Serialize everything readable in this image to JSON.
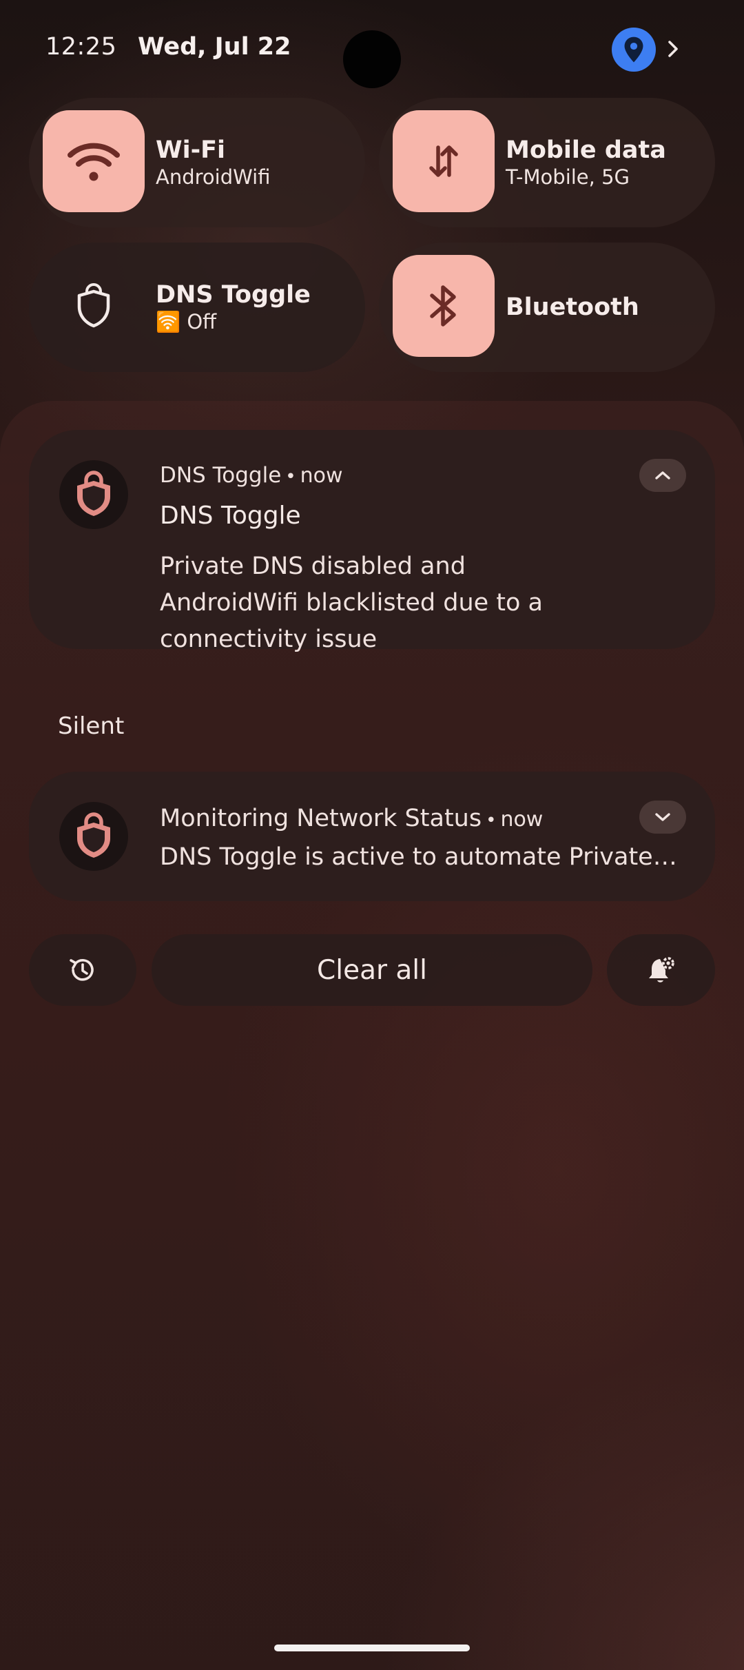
{
  "status_bar": {
    "time": "12:25",
    "date": "Wed, Jul 22",
    "location_icon": "location-pin-icon",
    "location_color": "#3d7ef2"
  },
  "quick_settings": {
    "accent_color": "#f7b6ab",
    "tiles": [
      {
        "title": "Wi-Fi",
        "subtitle": "AndroidWifi",
        "icon": "wifi-icon",
        "active": true
      },
      {
        "title": "Mobile data",
        "subtitle": "T-Mobile, 5G",
        "icon": "mobile-data-icon",
        "active": true
      },
      {
        "title": "DNS Toggle",
        "subtitle_badge": "🛜",
        "subtitle": "Off",
        "icon": "shield-icon",
        "active": false
      },
      {
        "title": "Bluetooth",
        "subtitle": "",
        "icon": "bluetooth-icon",
        "active": true
      }
    ]
  },
  "notifications": [
    {
      "app_name": "DNS Toggle",
      "separator": "•",
      "time": "now",
      "title": "DNS Toggle",
      "body": "Private DNS disabled and AndroidWifi blacklisted due to a connectivity issue",
      "expand_icon": "chevron-up-icon"
    }
  ],
  "silent_section": {
    "header": "Silent",
    "notifications": [
      {
        "app_name": "Monitoring Network Status",
        "separator": "•",
        "time": "now",
        "body": "DNS Toggle is active to automate Private DNS based on network status",
        "expand_icon": "chevron-down-icon"
      }
    ]
  },
  "footer": {
    "history_icon": "history-icon",
    "clear_all_label": "Clear all",
    "settings_icon": "notification-settings-icon"
  }
}
